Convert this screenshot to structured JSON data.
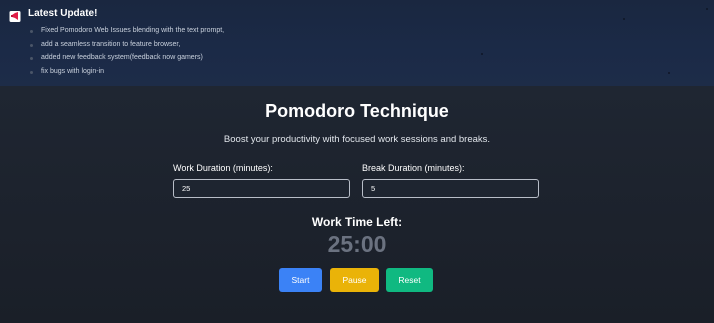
{
  "banner": {
    "icon": "megaphone-icon",
    "title": "Latest Update!",
    "items": [
      "Fixed Pomodoro Web Issues blending with the text prompt,",
      "add a seamless transition to feature browser,",
      "added new feedback system(feedback now gamers)",
      "fix bugs with login-in"
    ]
  },
  "page": {
    "title": "Pomodoro Technique",
    "subtitle": "Boost your productivity with focused work sessions and breaks."
  },
  "work": {
    "label": "Work Duration (minutes):",
    "value": "25"
  },
  "break": {
    "label": "Break Duration (minutes):",
    "value": "5"
  },
  "timer": {
    "label": "Work Time Left:",
    "value": "25:00"
  },
  "buttons": {
    "start": {
      "label": "Start",
      "color": "#3b82f6"
    },
    "pause": {
      "label": "Pause",
      "color": "#eab308"
    },
    "reset": {
      "label": "Reset",
      "color": "#10b981"
    }
  }
}
